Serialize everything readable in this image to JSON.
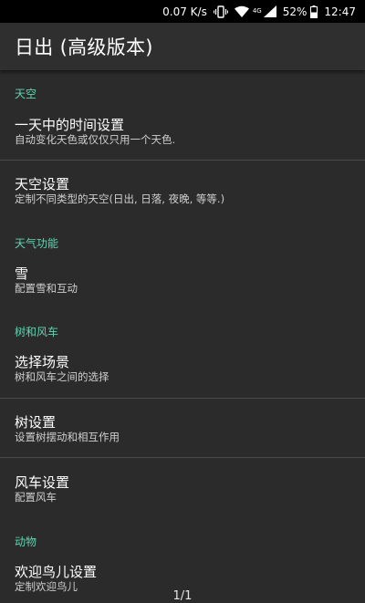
{
  "status_bar": {
    "net_speed": "0.07 K/s",
    "signal_label": "4G",
    "battery": "52%",
    "time": "12:47",
    "icons": [
      "vibrate-icon",
      "wifi-icon",
      "cell-signal-icon",
      "battery-icon"
    ]
  },
  "app_bar": {
    "title": "日出 (高级版本)"
  },
  "sections": {
    "sky": "天空",
    "weather": "天气功能",
    "trees": "树和风车",
    "animals": "动物"
  },
  "prefs": {
    "time_of_day": {
      "title": "一天中的时间设置",
      "summary": "自动变化天色或仅仅只用一个天色."
    },
    "sky_settings": {
      "title": "天空设置",
      "summary": "定制不同类型的天空(日出, 日落, 夜晚, 等等.)"
    },
    "snow": {
      "title": "雪",
      "summary": "配置雪和互动"
    },
    "scene": {
      "title": "选择场景",
      "summary": "树和风车之间的选择"
    },
    "tree": {
      "title": "树设置",
      "summary": "设置树摆动和相互作用"
    },
    "windmill": {
      "title": "风车设置",
      "summary": "配置风车"
    },
    "birds": {
      "title": "欢迎鸟儿设置",
      "summary": "定制欢迎鸟儿"
    }
  },
  "page_indicator": "1/1",
  "colors": {
    "accent": "#5fd3b0",
    "background": "#2b2b2b",
    "app_bar": "#2f2f2f",
    "status_bar": "#000000"
  }
}
